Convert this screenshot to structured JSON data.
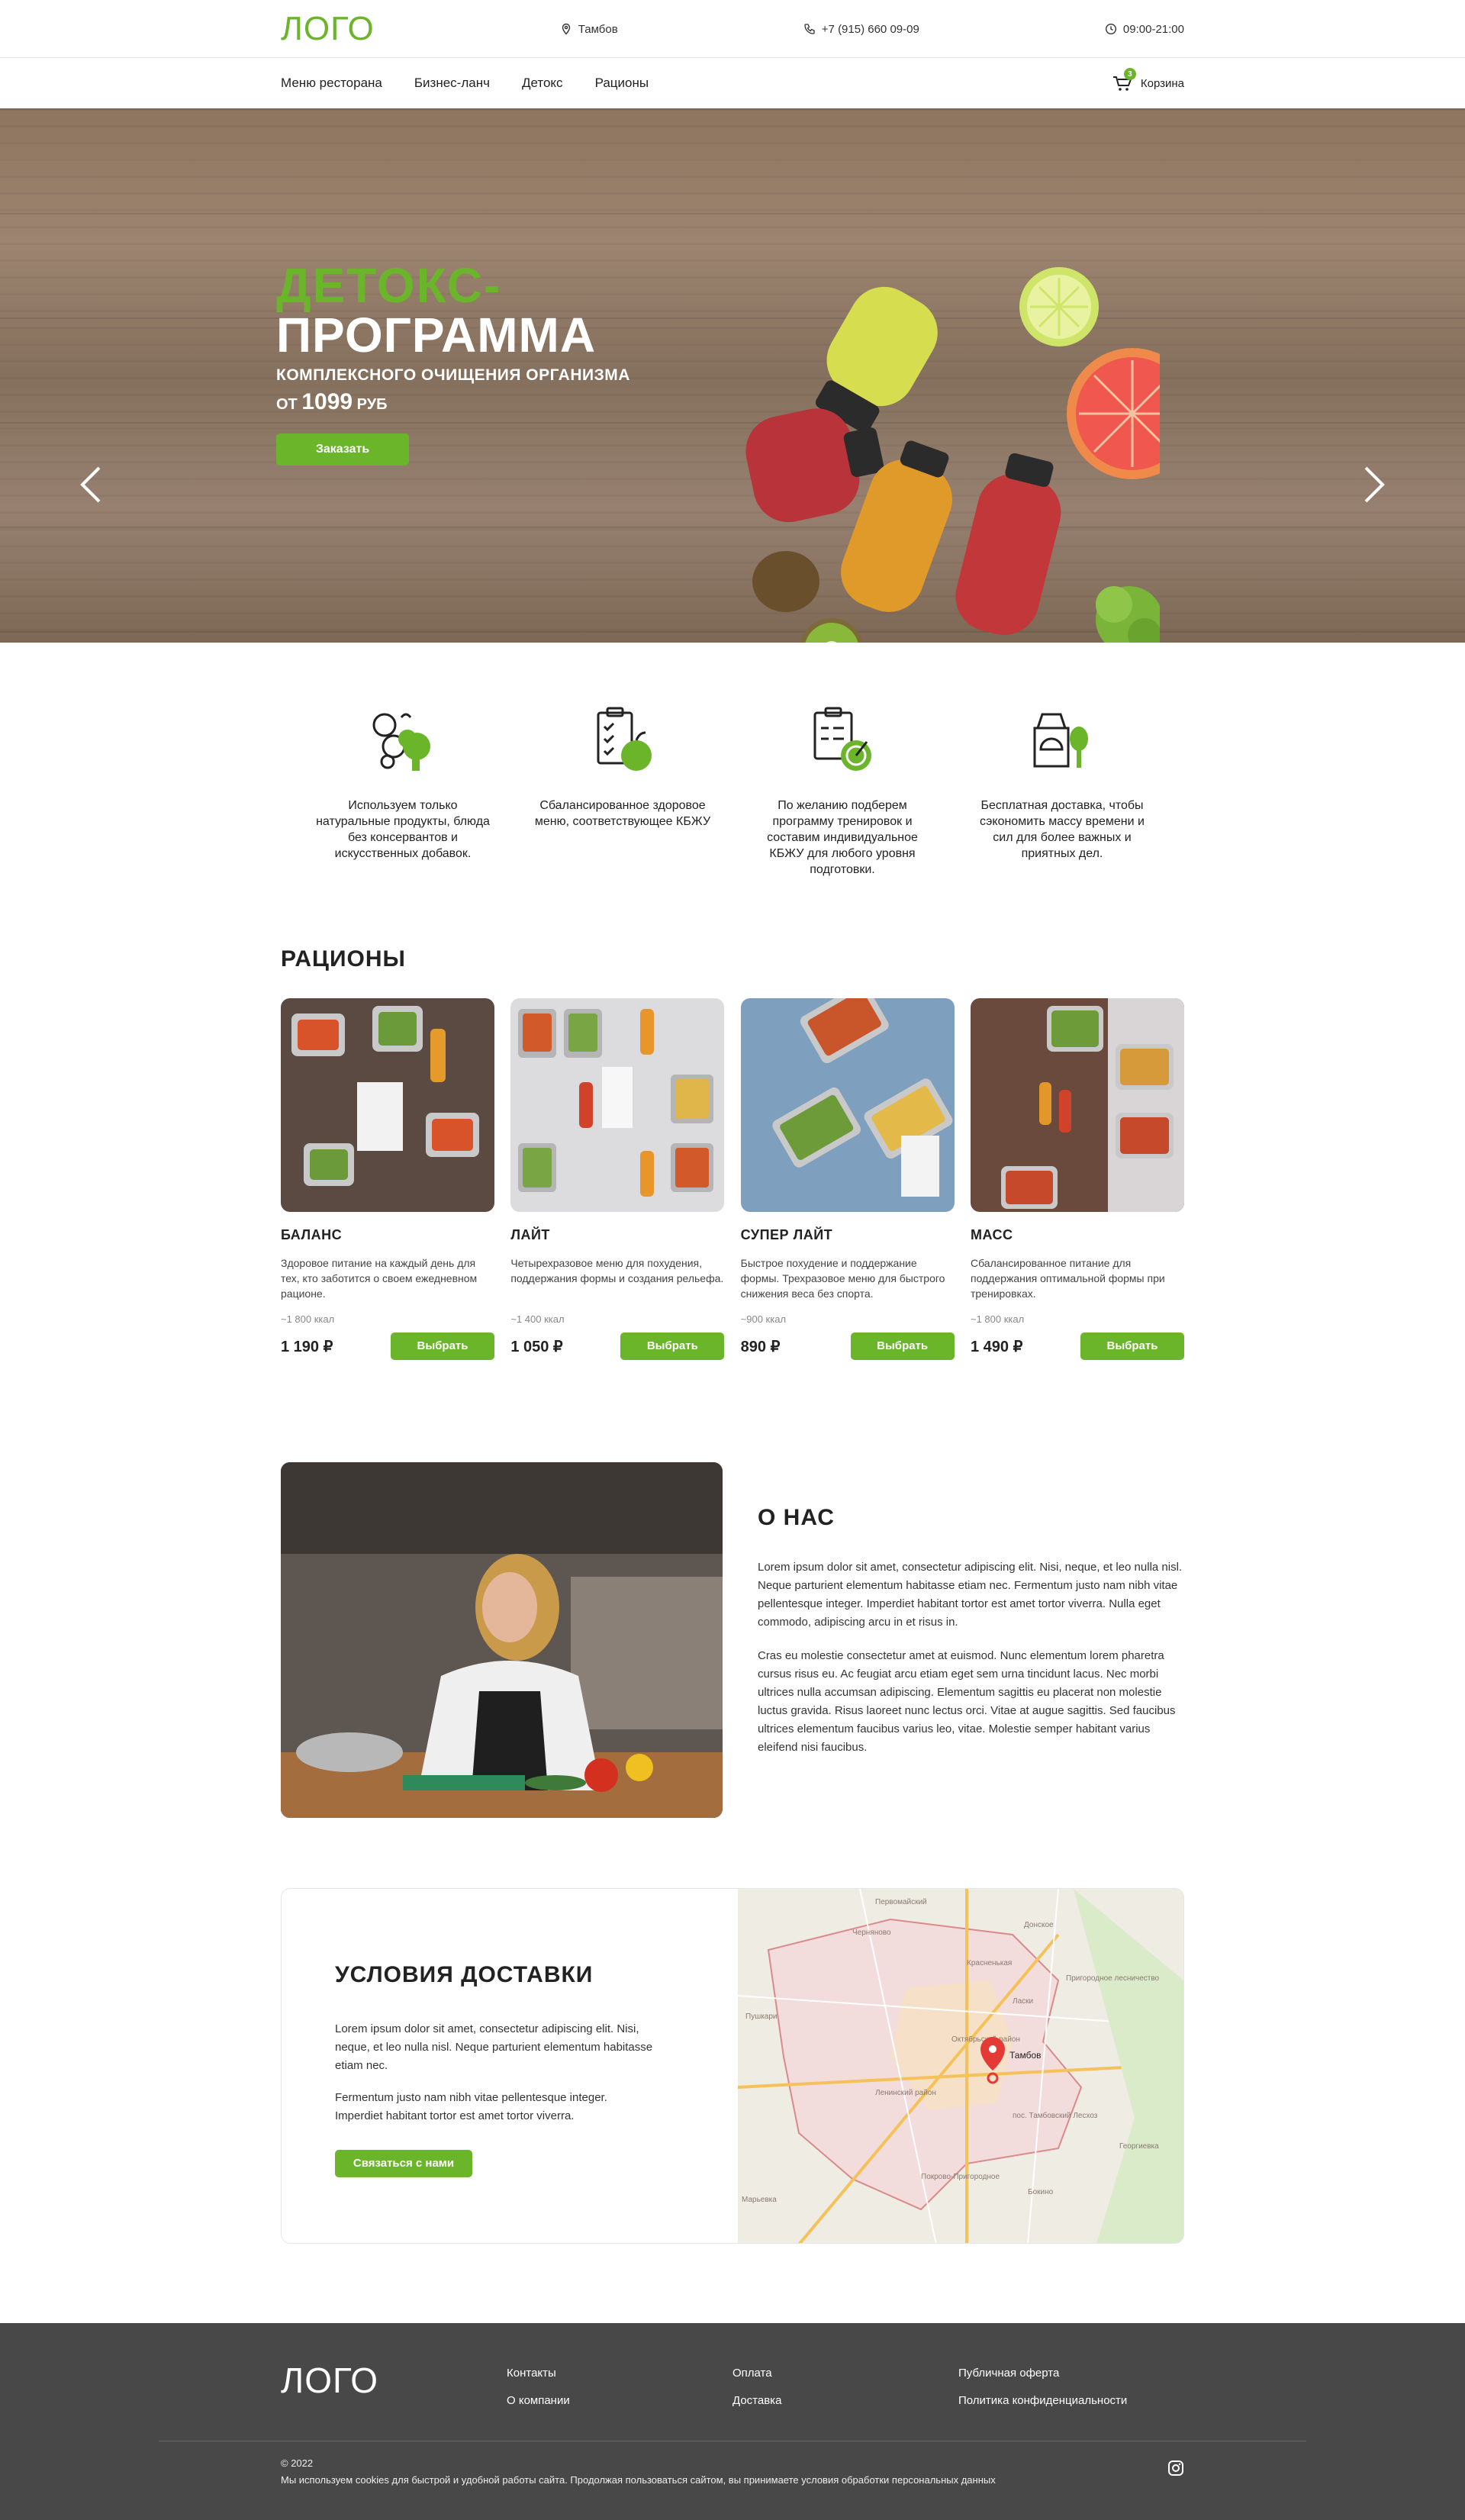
{
  "header": {
    "logo": "ЛОГО",
    "city": "Тамбов",
    "phone": "+7 (915) 660 09-09",
    "hours": "09:00-21:00"
  },
  "nav": {
    "items": [
      "Меню ресторана",
      "Бизнес-ланч",
      "Детокс",
      "Рационы"
    ],
    "cart_label": "Корзина",
    "cart_count": "3"
  },
  "hero": {
    "title_green": "ДЕТОКС-",
    "title_white": "ПРОГРАММА",
    "subtitle": "КОМПЛЕКСНОГО ОЧИЩЕНИЯ ОРГАНИЗМА",
    "price_prefix": "ОТ",
    "price_value": "1099",
    "price_suffix": "РУБ",
    "button": "Заказать",
    "slide_count": 4,
    "active_slide": 2
  },
  "features": [
    {
      "text": "Используем только натуральные продукты, блюда без консервантов и искусственных добавок.",
      "icon": "natural-food-icon"
    },
    {
      "text": "Сбалансированное здоровое меню, соответствующее КБЖУ",
      "icon": "checklist-icon"
    },
    {
      "text": "По желанию подберем программу тренировок и составим индивидуальное КБЖУ для любого уровня подготовки.",
      "icon": "workout-plan-icon"
    },
    {
      "text": "Бесплатная доставка, чтобы сэкономить массу времени и сил для более важных и приятных дел.",
      "icon": "delivery-bag-icon"
    }
  ],
  "rations": {
    "title": "РАЦИОНЫ",
    "select_label": "Выбрать",
    "cards": [
      {
        "name": "БАЛАНС",
        "desc": "Здоровое питание на каждый день для тех, кто  заботится о своем ежедневном рационе.",
        "kcal": "~1 800 ккал",
        "price": "1 190 ₽",
        "bg": "#5a4a42"
      },
      {
        "name": "ЛАЙТ",
        "desc": "Четырехразовое меню для похудения, поддержания формы и создания рельефа.",
        "kcal": "~1 400 ккал",
        "price": "1 050 ₽",
        "bg": "#d9d9db"
      },
      {
        "name": "СУПЕР ЛАЙТ",
        "desc": "Быстрое похудение и поддержание формы. Трехразовое меню для быстрого снижения веса без спорта.",
        "kcal": "~900 ккал",
        "price": "890 ₽",
        "bg": "#7f9fbf"
      },
      {
        "name": "МАСС",
        "desc": "Сбалансированное питание для поддержания оптимальной формы при тренировках.",
        "kcal": "~1 800 ккал",
        "price": "1 490 ₽",
        "bg": "#6b4a3e"
      }
    ]
  },
  "about": {
    "title": "О НАС",
    "p1": "Lorem ipsum dolor sit amet, consectetur adipiscing elit. Nisi, neque, et leo nulla nisl. Neque parturient elementum habitasse etiam nec. Fermentum justo nam nibh vitae pellentesque integer. Imperdiet habitant tortor est amet tortor viverra. Nulla eget commodo, adipiscing arcu in et risus in.",
    "p2": "Cras eu molestie consectetur amet at euismod. Nunc elementum lorem pharetra cursus risus eu. Ac feugiat arcu etiam eget sem urna tincidunt lacus. Nec morbi ultrices nulla accumsan adipiscing. Elementum sagittis eu placerat non molestie luctus gravida. Risus laoreet nunc lectus orci. Vitae at augue sagittis. Sed faucibus ultrices elementum faucibus varius leo, vitae. Molestie semper habitant varius eleifend nisi faucibus."
  },
  "delivery": {
    "title": "УСЛОВИЯ ДОСТАВКИ",
    "p1": "Lorem ipsum dolor sit amet, consectetur adipiscing elit. Nisi, neque, et leo nulla nisl. Neque parturient elementum habitasse etiam nec.",
    "p2": " Fermentum justo nam nibh vitae pellentesque integer. Imperdiet habitant tortor est amet tortor viverra.",
    "button": "Связаться с нами",
    "map_pin_label": "Тамбов",
    "map_labels": [
      "Первомайский",
      "Донское",
      "Красненькая",
      "Пригородное лесничество",
      "Пушкари",
      "Октябрьский район",
      "Ленинский район",
      "пос. Тамбовский Лесхоз",
      "Покрово-Пригородное",
      "Георгиевка",
      "Марьевка",
      "Бокино",
      "Черняново",
      "Ласки"
    ]
  },
  "footer": {
    "logo": "ЛОГО",
    "col1": [
      "Контакты",
      "О компании"
    ],
    "col2": [
      "Оплата",
      "Доставка"
    ],
    "col3": [
      "Публичная оферта",
      "Политика конфиденциальности"
    ],
    "copyright": "© 2022",
    "cookies": "Мы используем cookies для быстрой и удобной работы сайта. Продолжая пользоваться сайтом, вы принимаете условия обработки персональных данных"
  },
  "colors": {
    "accent": "#6bb52a",
    "footer": "#484848"
  }
}
